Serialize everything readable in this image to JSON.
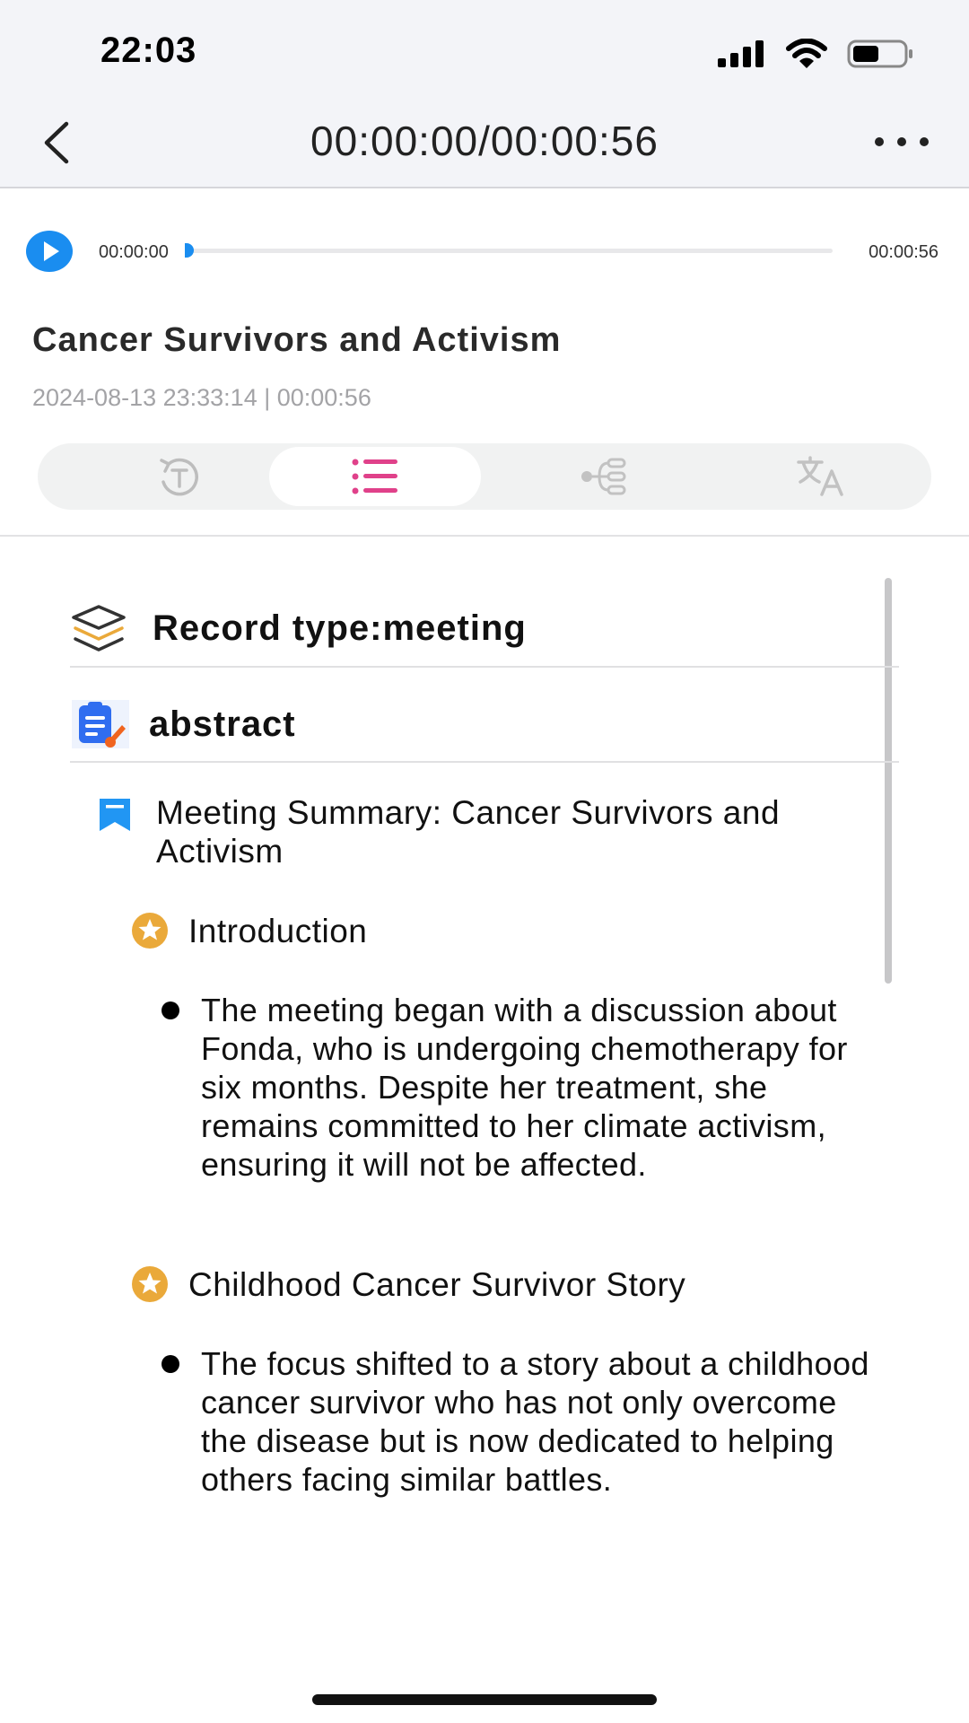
{
  "status_bar": {
    "time": "22:03"
  },
  "header": {
    "title": "00:00:00/00:00:56"
  },
  "player": {
    "current_time": "00:00:00",
    "duration": "00:00:56",
    "progress": 0.0
  },
  "record": {
    "title": "Cancer Survivors and Activism",
    "meta": "2024-08-13 23:33:14 | 00:00:56"
  },
  "tabs": [
    {
      "name": "transcript",
      "icon": "transcript-icon",
      "active": false
    },
    {
      "name": "summary",
      "icon": "list-icon",
      "active": true
    },
    {
      "name": "mindmap",
      "icon": "mindmap-icon",
      "active": false
    },
    {
      "name": "translate",
      "icon": "translate-icon",
      "active": false
    }
  ],
  "content": {
    "record_type": "Record type:meeting",
    "abstract_label": "abstract",
    "summary_heading": "Meeting Summary: Cancer Survivors and Activism",
    "sections": [
      {
        "heading": "Introduction",
        "bullets": [
          "The meeting began with a discussion about Fonda, who is undergoing chemotherapy for six months. Despite her treatment, she remains committed to her climate activism, ensuring it will not be affected."
        ]
      },
      {
        "heading": "Childhood Cancer Survivor Story",
        "bullets": [
          "The focus shifted to a story about a childhood cancer survivor who has not only overcome the disease but is now dedicated to helping others facing similar battles."
        ]
      }
    ]
  },
  "colors": {
    "accent_blue": "#1a8df0",
    "accent_pink": "#e0418a",
    "star_orange": "#eaa93a"
  }
}
